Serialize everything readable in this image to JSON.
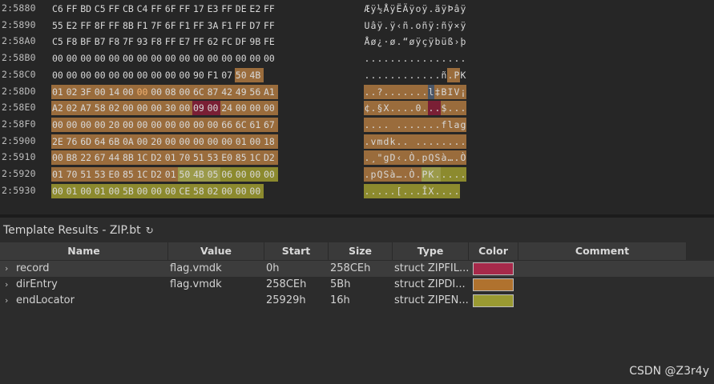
{
  "hex_rows": [
    {
      "addr": "2:5880",
      "bytes": [
        "C6",
        "FF",
        "BD",
        "C5",
        "FF",
        "CB",
        "C4",
        "FF",
        "6F",
        "FF",
        "17",
        "E3",
        "FF",
        "DE",
        "E2",
        "FF"
      ],
      "ascii": "Æÿ½ÅÿËÄÿoÿ.ãÿÞâÿ"
    },
    {
      "addr": "2:5890",
      "bytes": [
        "55",
        "E2",
        "FF",
        "8F",
        "FF",
        "8B",
        "F1",
        "7F",
        "6F",
        "F1",
        "FF",
        "3A",
        "F1",
        "FF",
        "D7",
        "FF"
      ],
      "ascii": "Uâÿ.ÿ‹ñ.oñÿ:ñÿ×ÿ"
    },
    {
      "addr": "2:58A0",
      "bytes": [
        "C5",
        "F8",
        "BF",
        "B7",
        "F8",
        "7F",
        "93",
        "F8",
        "FF",
        "E7",
        "FF",
        "62",
        "FC",
        "DF",
        "9B",
        "FE"
      ],
      "ascii": "Åø¿·ø.“øÿçÿbüß›þ"
    },
    {
      "addr": "2:58B0",
      "bytes": [
        "00",
        "00",
        "00",
        "00",
        "00",
        "00",
        "00",
        "00",
        "00",
        "00",
        "00",
        "00",
        "00",
        "00",
        "00",
        "00"
      ],
      "ascii": "................"
    },
    {
      "addr": "2:58C0",
      "bytes": [
        "00",
        "00",
        "00",
        "00",
        "00",
        "00",
        "00",
        "00",
        "00",
        "00",
        "90",
        "F1",
        "07",
        "50",
        "4B"
      ],
      "ascii": "............ñ.PK"
    },
    {
      "addr": "2:58D0",
      "bytes": [
        "01",
        "02",
        "3F",
        "00",
        "14",
        "00",
        "00",
        "00",
        "08",
        "00",
        "6C",
        "87",
        "42",
        "49",
        "56",
        "A1"
      ],
      "ascii": "..?.......l‡BIV¡"
    },
    {
      "addr": "2:58E0",
      "bytes": [
        "A2",
        "02",
        "A7",
        "58",
        "02",
        "00",
        "00",
        "00",
        "30",
        "00",
        "09",
        "00",
        "24",
        "00",
        "00",
        "00"
      ],
      "ascii": "¢.§X....0...$..."
    },
    {
      "addr": "2:58F0",
      "bytes": [
        "00",
        "00",
        "00",
        "00",
        "20",
        "00",
        "00",
        "00",
        "00",
        "00",
        "00",
        "00",
        "66",
        "6C",
        "61",
        "67"
      ],
      "ascii": ".... .......flag"
    },
    {
      "addr": "2:5900",
      "bytes": [
        "2E",
        "76",
        "6D",
        "64",
        "6B",
        "0A",
        "00",
        "20",
        "00",
        "00",
        "00",
        "00",
        "00",
        "01",
        "00",
        "18"
      ],
      "ascii": ".vmdk.. ........"
    },
    {
      "addr": "2:5910",
      "bytes": [
        "00",
        "B8",
        "22",
        "67",
        "44",
        "8B",
        "1C",
        "D2",
        "01",
        "70",
        "51",
        "53",
        "E0",
        "85",
        "1C",
        "D2"
      ],
      "ascii": ".¸\"gD‹.Ò.pQSà….Ò"
    },
    {
      "addr": "2:5920",
      "bytes": [
        "01",
        "70",
        "51",
        "53",
        "E0",
        "85",
        "1C",
        "D2",
        "01",
        "50",
        "4B",
        "05",
        "06",
        "00",
        "00",
        "00"
      ],
      "ascii": ".pQSà….Ò.PK....."
    },
    {
      "addr": "2:5930",
      "bytes": [
        "00",
        "01",
        "00",
        "01",
        "00",
        "5B",
        "00",
        "00",
        "00",
        "CE",
        "58",
        "02",
        "00",
        "00",
        "00"
      ],
      "ascii": ".....[...ÎX...."
    }
  ],
  "template": {
    "title": "Template Results - ZIP.bt",
    "refresh_icon": "↻",
    "columns": [
      "Name",
      "Value",
      "Start",
      "Size",
      "Type",
      "Color",
      "Comment"
    ],
    "rows": [
      {
        "name": "record",
        "value": "flag.vmdk",
        "start": "0h",
        "size": "258CEh",
        "type": "struct ZIPFIL...",
        "color": "#a6294a",
        "caret": "›"
      },
      {
        "name": "dirEntry",
        "value": "flag.vmdk",
        "start": "258CEh",
        "size": "5Bh",
        "type": "struct ZIPDI...",
        "color": "#b0722e",
        "caret": "›"
      },
      {
        "name": "endLocator",
        "value": "25929h",
        "start": "25929h",
        "size": "16h",
        "type": "struct ZIPEN...",
        "color": "#9a9a32",
        "caret": "›"
      }
    ]
  },
  "watermark": "CSDN @Z3r4y"
}
